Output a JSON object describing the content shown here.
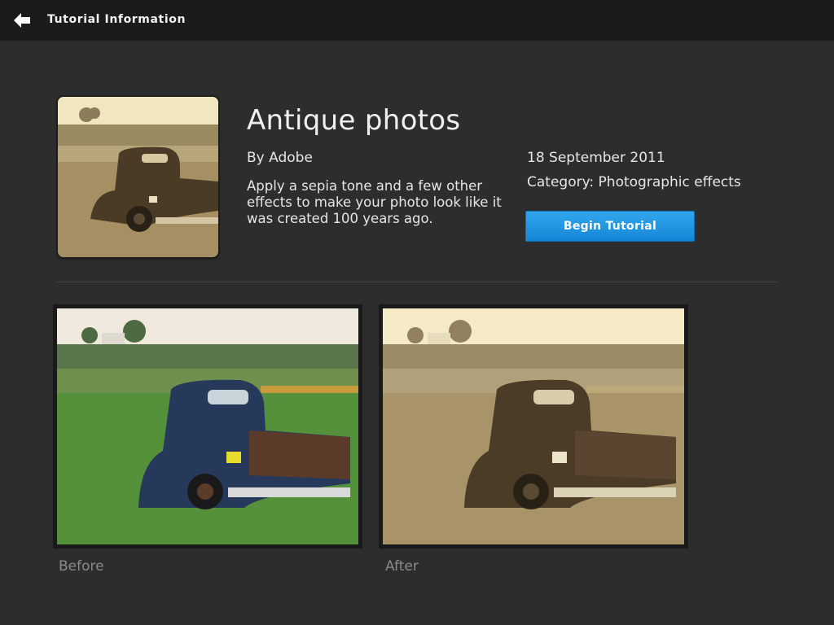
{
  "topbar": {
    "back_icon": "back-arrow-icon",
    "title": "Tutorial Information"
  },
  "tutorial": {
    "title": "Antique photos",
    "author": "By Adobe",
    "description": "Apply a sepia tone and a few other effects to make your photo look like it was created 100 years ago.",
    "date": "18 September 2011",
    "category": "Category: Photographic effects",
    "begin_label": "Begin Tutorial"
  },
  "photos": {
    "before_label": "Before",
    "after_label": "After"
  },
  "colors": {
    "background": "#2d2d2d",
    "topbar": "#1b1b1b",
    "accent": "#1e93e0"
  }
}
